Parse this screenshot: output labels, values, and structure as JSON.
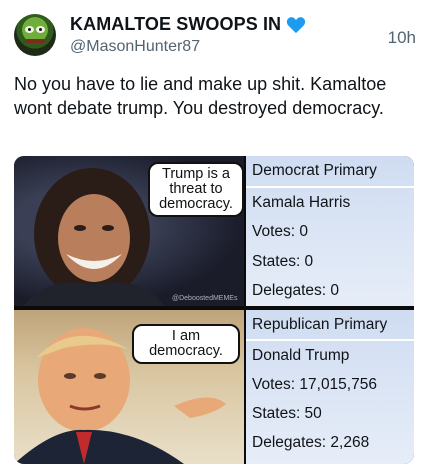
{
  "post": {
    "display_name": "KAMALTOE SWOOPS IN",
    "handle": "@MasonHunter87",
    "time": "10h",
    "text": "No you have to lie and make up shit. Kamaltoe wont debate trump. You destroyed democracy.",
    "avatar_icon": "frog-avatar",
    "badge_icon": "blue-heart-icon",
    "badge_color": "#1d9bf0"
  },
  "meme": {
    "top": {
      "bubble": [
        "Trump is a",
        "threat to",
        "democracy."
      ],
      "stats": [
        "Democrat Primary",
        "Kamala Harris",
        "Votes: 0",
        "States: 0",
        "Delegates: 0"
      ],
      "watermark": "@DeboostedMEMEs"
    },
    "bottom": {
      "bubble": [
        "I am",
        "democracy."
      ],
      "stats": [
        "Republican Primary",
        "Donald Trump",
        "Votes: 17,015,756",
        "States: 50",
        "Delegates: 2,268"
      ]
    }
  }
}
